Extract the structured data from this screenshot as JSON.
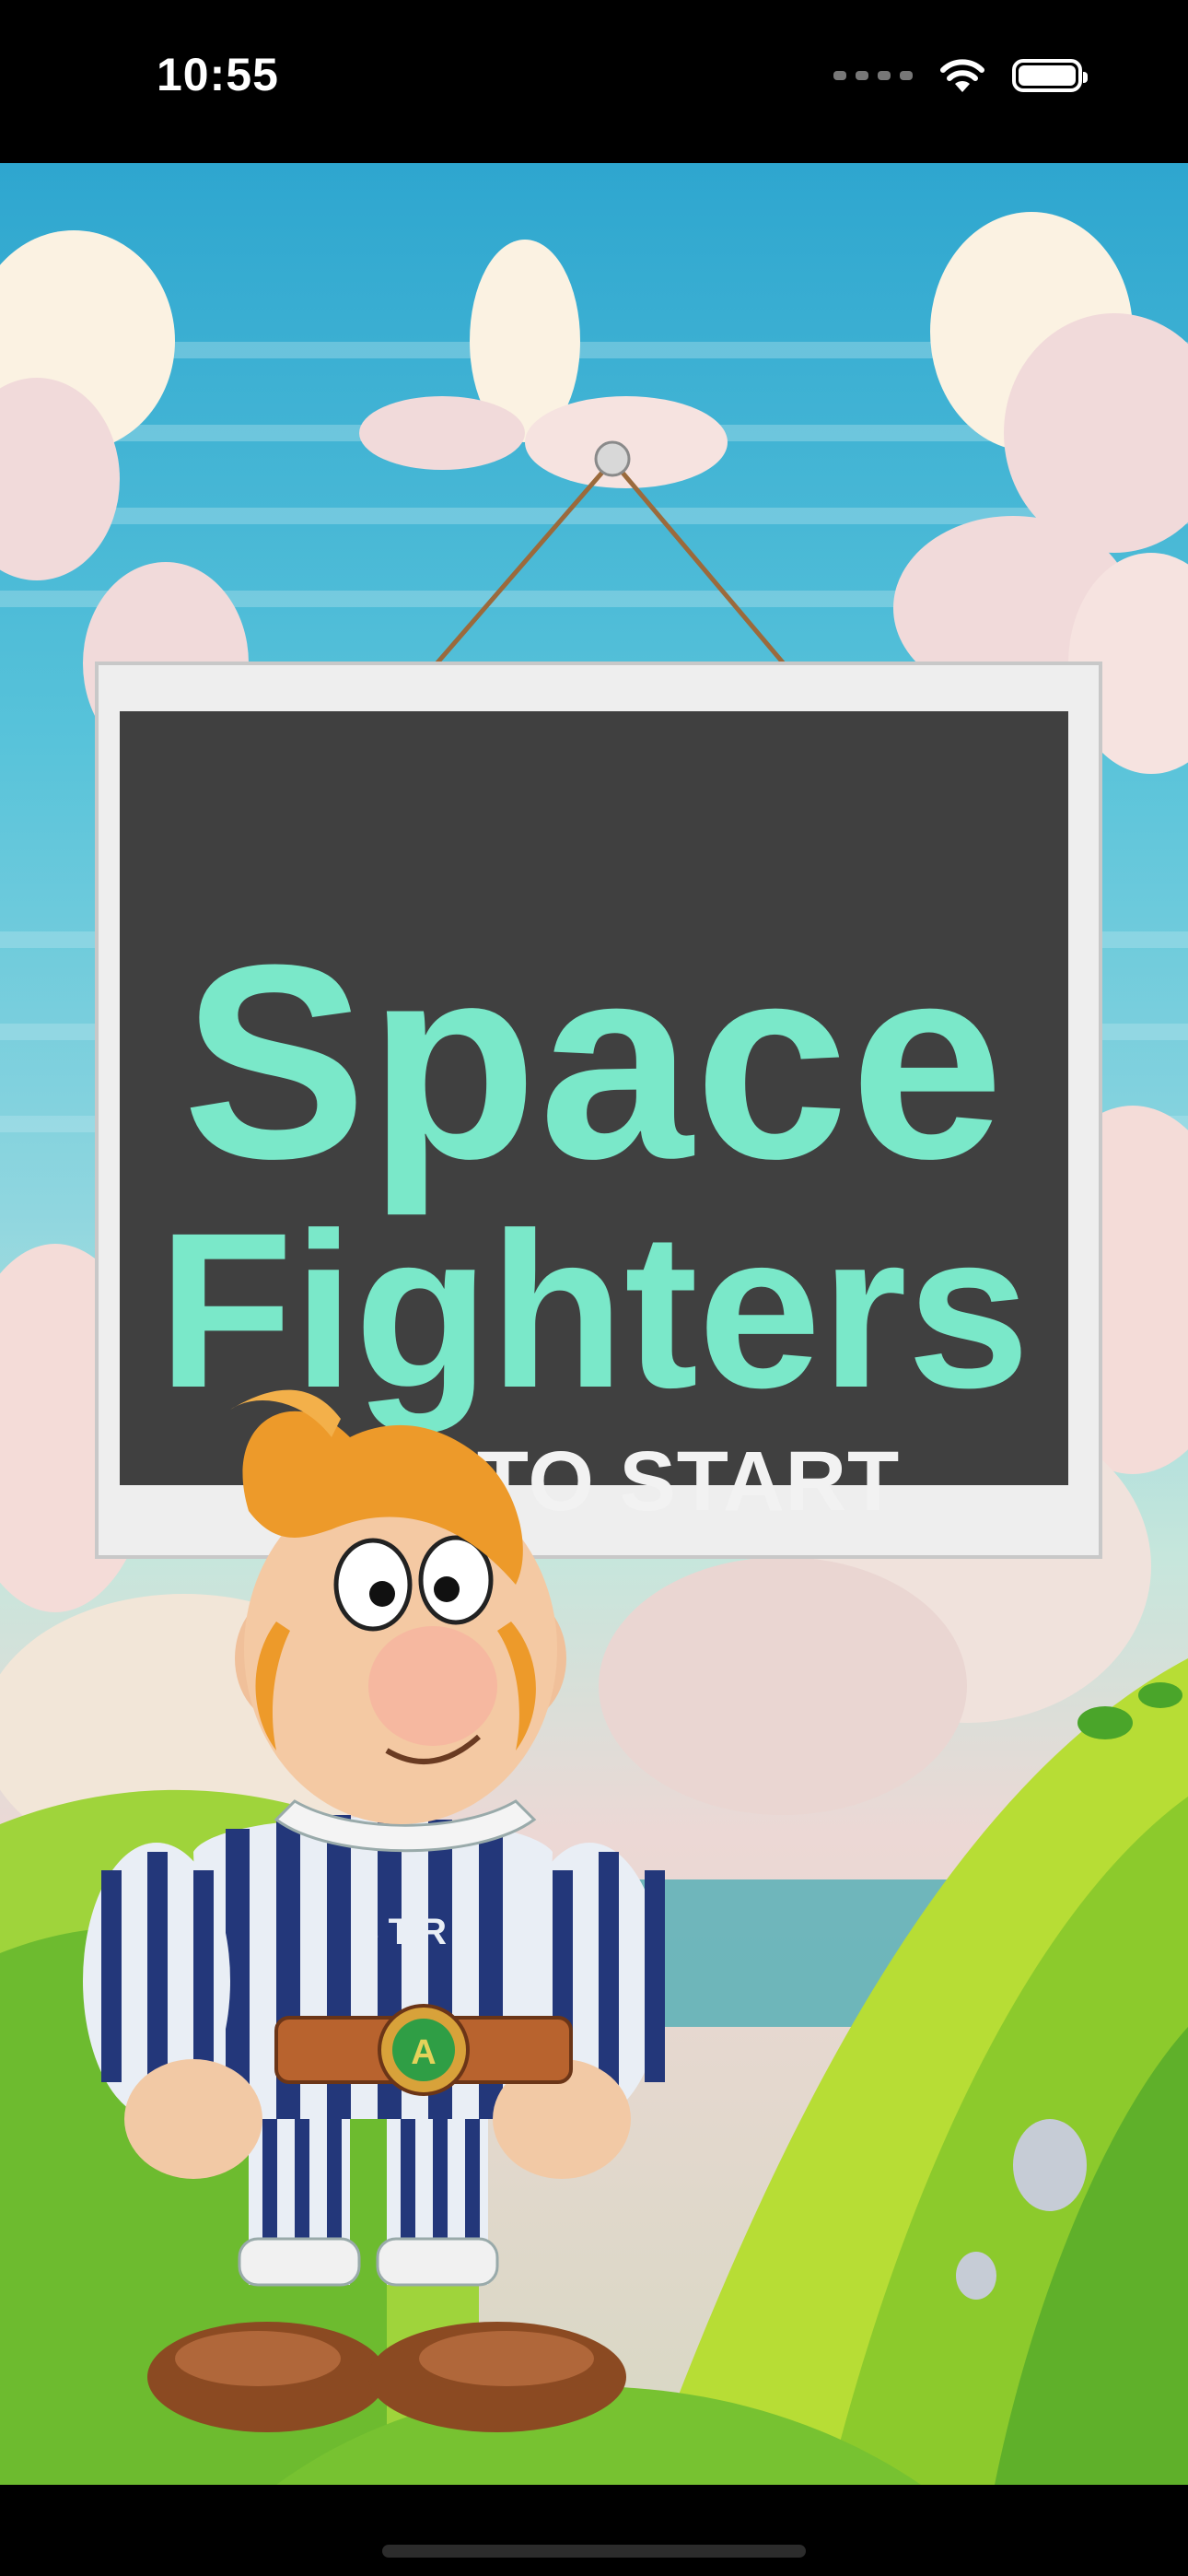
{
  "status_bar": {
    "time": "10:55"
  },
  "sign": {
    "title_line1": "Space",
    "title_line2": "Fighters",
    "prompt": "TAP TO START"
  },
  "character": {
    "shirt_text": "STR",
    "belt_badge": "A"
  },
  "icons": [
    "signal-dots-icon",
    "wifi-icon",
    "battery-icon"
  ],
  "colors": {
    "title": "#7ae8c9",
    "board": "#3f3f3f",
    "frame": "#f2f2f2",
    "prompt": "#f2f2f2"
  }
}
